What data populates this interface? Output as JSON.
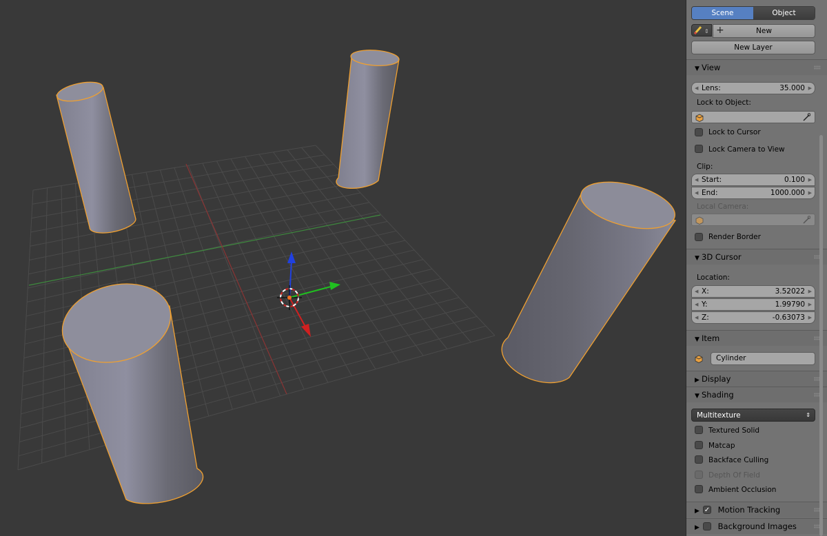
{
  "viewport": {
    "label": "3D Viewport",
    "objects": [
      "Cylinder"
    ]
  },
  "panel": {
    "tabs": {
      "scene": "Scene",
      "object": "Object"
    },
    "new_button": "New",
    "new_layer_button": "New Layer",
    "view": {
      "title": "View",
      "lens_label": "Lens:",
      "lens_value": "35.000",
      "lock_to_object_label": "Lock to Object:",
      "lock_to_cursor": "Lock to Cursor",
      "lock_camera_to_view": "Lock Camera to View",
      "clip_label": "Clip:",
      "start_label": "Start:",
      "start_value": "0.100",
      "end_label": "End:",
      "end_value": "1000.000",
      "local_camera_label": "Local Camera:",
      "render_border": "Render Border"
    },
    "cursor": {
      "title": "3D Cursor",
      "location_label": "Location:",
      "x_label": "X:",
      "x_value": "3.52022",
      "y_label": "Y:",
      "y_value": "1.99790",
      "z_label": "Z:",
      "z_value": "-0.63073"
    },
    "item": {
      "title": "Item",
      "name": "Cylinder"
    },
    "display": {
      "title": "Display"
    },
    "shading": {
      "title": "Shading",
      "mode": "Multitexture",
      "textured_solid": "Textured Solid",
      "matcap": "Matcap",
      "backface_culling": "Backface Culling",
      "depth_of_field": "Depth Of Field",
      "ambient_occlusion": "Ambient Occlusion"
    },
    "motion_tracking": {
      "title": "Motion Tracking",
      "checked": true
    },
    "background_images": {
      "title": "Background Images",
      "checked": false
    }
  },
  "colors": {
    "viewport_bg": "#393939",
    "panel_bg": "#737373",
    "selection_outline": "#f0a030",
    "active_tab": "#5680c2",
    "axis_x": "#d02020",
    "axis_y": "#20c020",
    "axis_z": "#2040e0"
  },
  "icons": {
    "tabs_tool": "pencil-icon",
    "add": "plus-icon",
    "object": "cube-icon",
    "eyedropper": "eyedropper-icon",
    "panel_grip": "grip-icon",
    "expanded": "triangle-down-icon",
    "collapsed": "triangle-right-icon"
  }
}
